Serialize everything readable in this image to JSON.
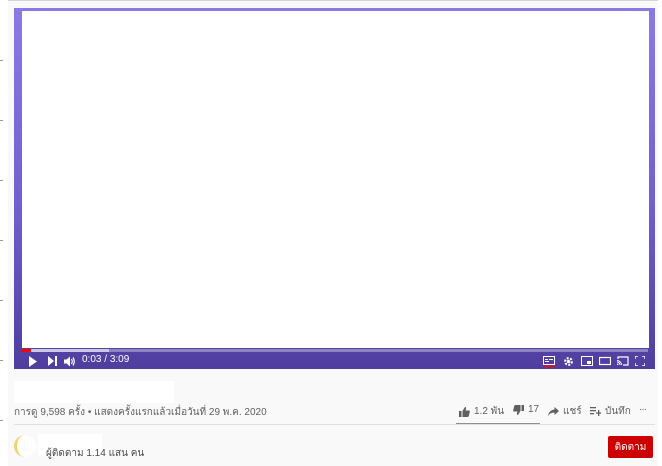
{
  "player": {
    "time_current": "0:03",
    "time_separator": " / ",
    "time_total": "3:09",
    "progress_fraction": 0.016,
    "accent_color": "#ff0000"
  },
  "video": {
    "title": "",
    "views": "การดู 9,598 ครั้ง",
    "separator": " • ",
    "premiere": "แสดงครั้งแรกแล้วเมื่อวันที่ 29 พ.ค. 2020",
    "likes": "1.2 พัน",
    "dislikes": "17",
    "share_label": "แชร์",
    "save_label": "บันทึก",
    "more_label": "···"
  },
  "channel": {
    "name": "",
    "subscribers": "ผู้ติดตาม 1.14 แสน คน",
    "subscribe_label": "ติดตาม",
    "subscribe_color": "#cc0000"
  },
  "icons": [
    "play-icon",
    "next-icon",
    "volume-icon",
    "subtitles-icon",
    "settings-icon",
    "miniplayer-icon",
    "theater-icon",
    "cast-icon",
    "fullscreen-icon",
    "like-icon",
    "dislike-icon",
    "share-icon",
    "save-icon",
    "more-icon"
  ]
}
